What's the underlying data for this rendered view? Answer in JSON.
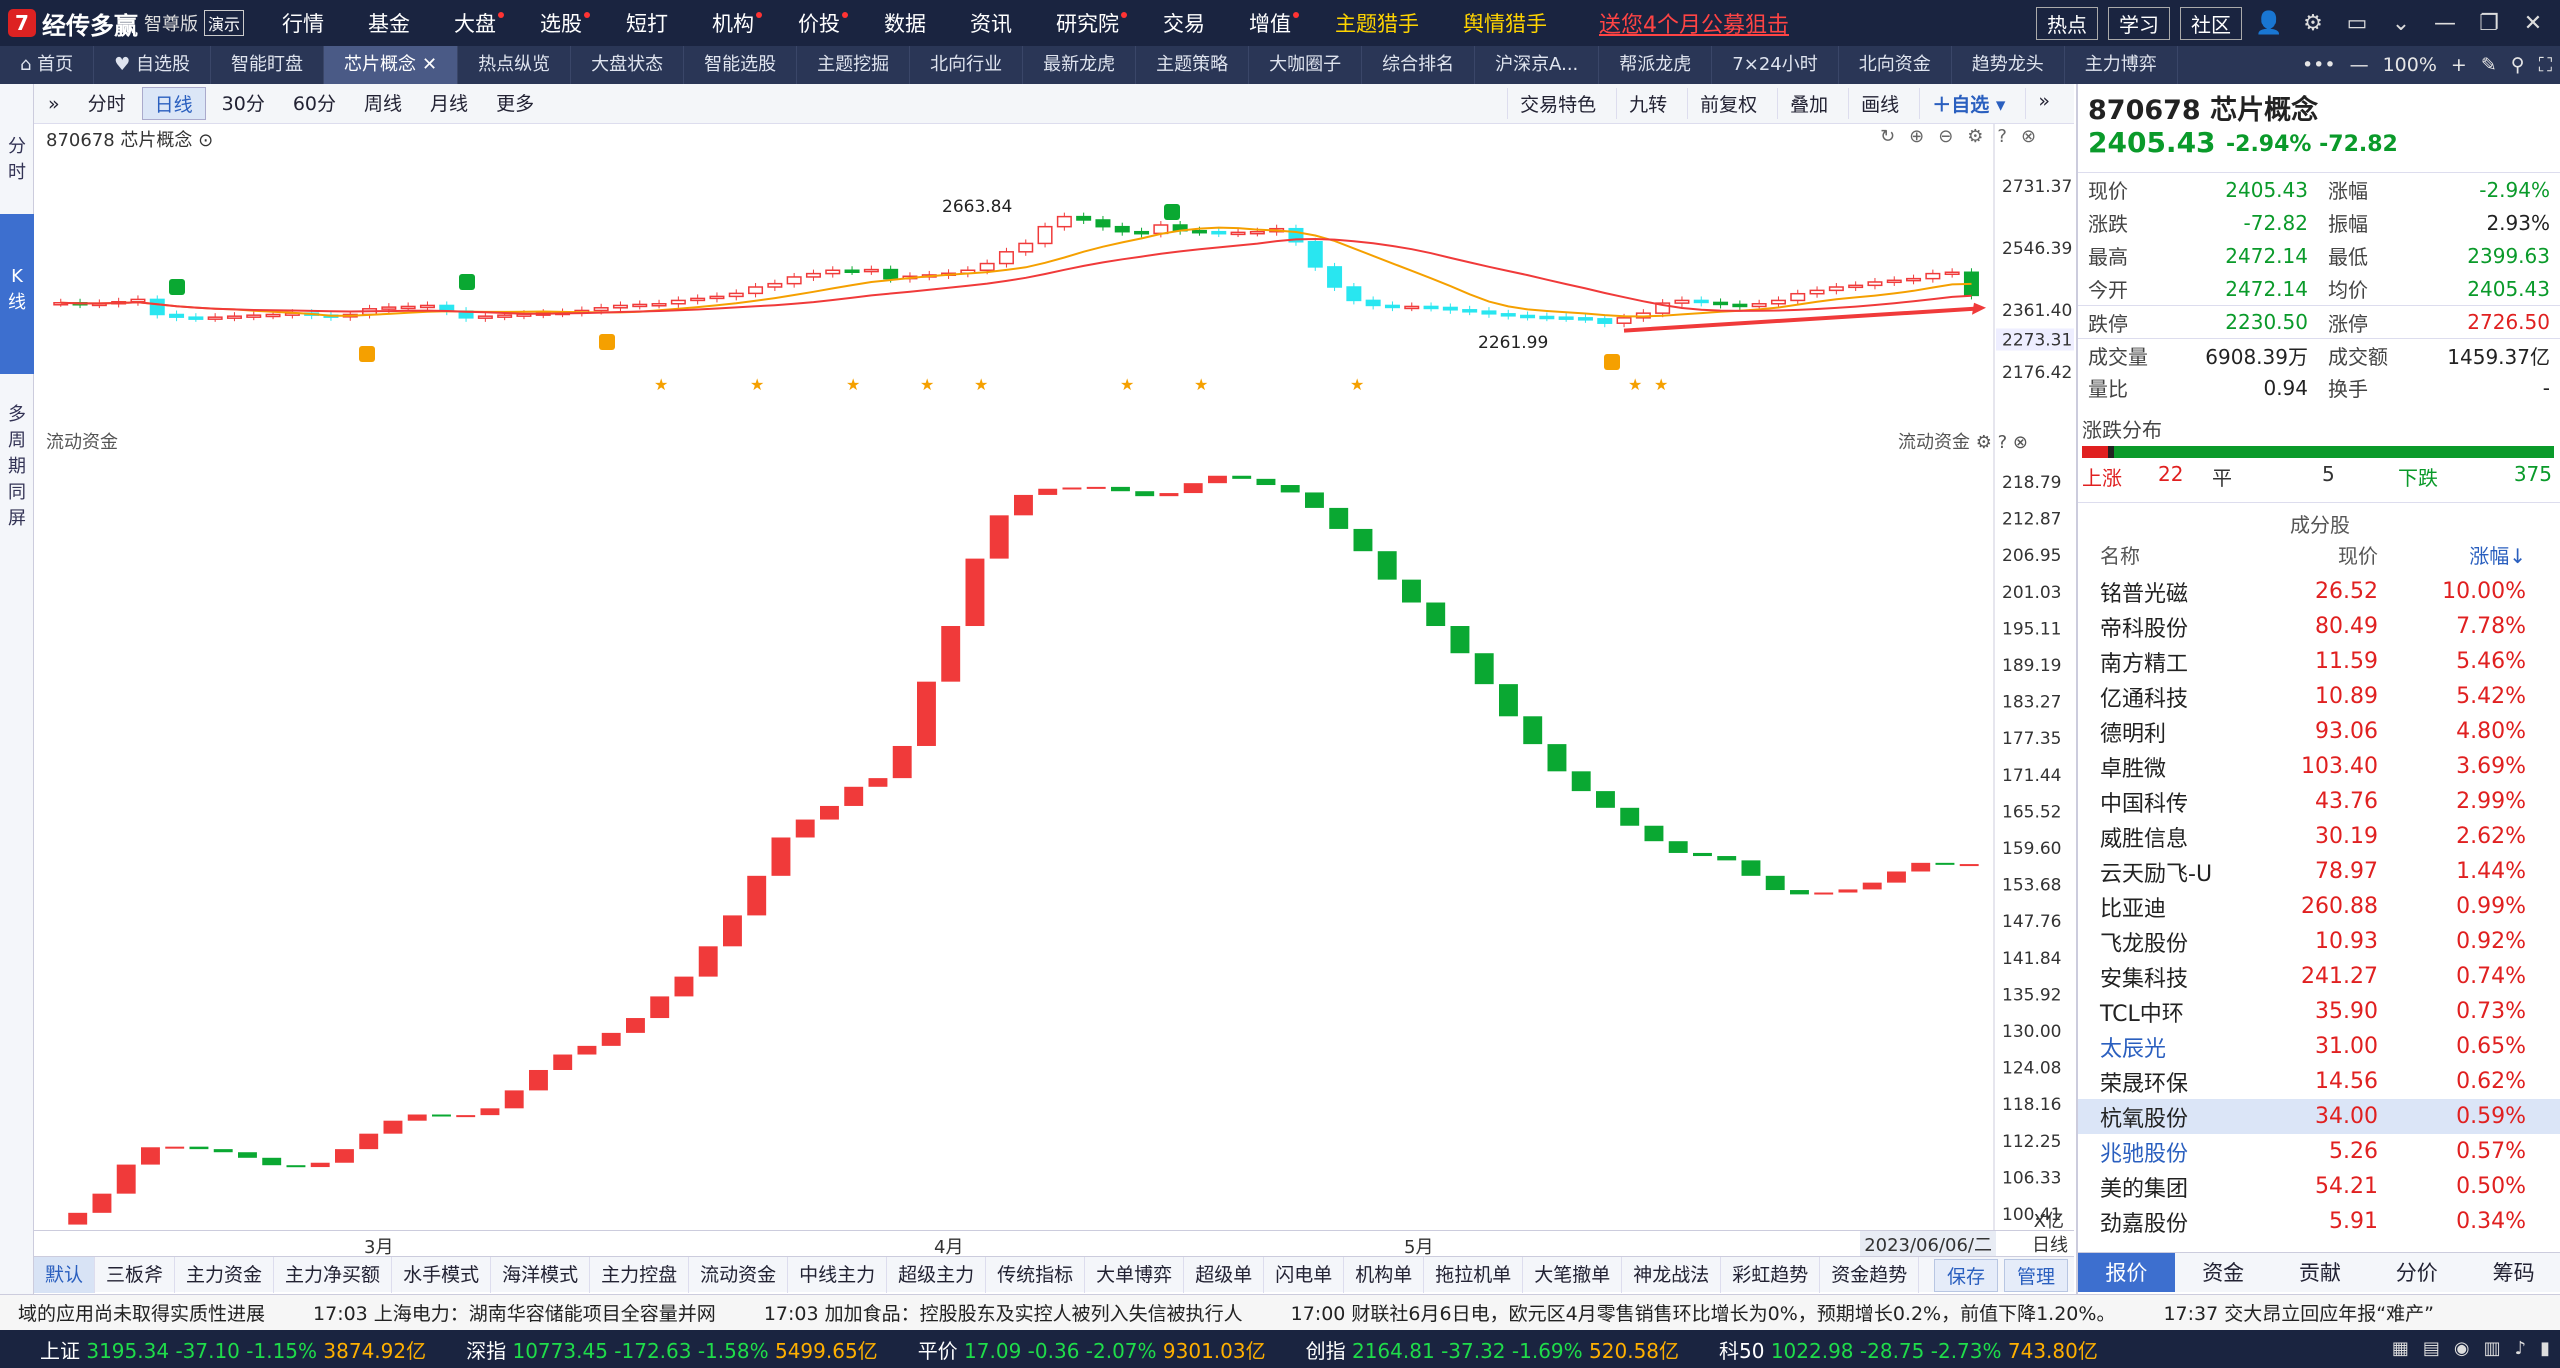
{
  "app": {
    "logo_mark": "7",
    "name": "经传多赢",
    "edition": "智尊版",
    "demo": "演示"
  },
  "main_menu": [
    "行情",
    "基金",
    "大盘",
    "选股",
    "短打",
    "机构",
    "价投",
    "数据",
    "资讯",
    "研究院",
    "交易",
    "增值",
    "主题猎手",
    "舆情猎手"
  ],
  "promo": "送您4个月公募狙击",
  "top_buttons": [
    "热点",
    "学习",
    "社区"
  ],
  "tabs": [
    {
      "label": "首页",
      "icon": "home-icon"
    },
    {
      "label": "自选股",
      "icon": "heart-icon"
    },
    {
      "label": "智能盯盘"
    },
    {
      "label": "芯片概念",
      "active": true,
      "close": "✕"
    },
    {
      "label": "热点纵览"
    },
    {
      "label": "大盘状态"
    },
    {
      "label": "智能选股"
    },
    {
      "label": "主题挖掘"
    },
    {
      "label": "北向行业"
    },
    {
      "label": "最新龙虎"
    },
    {
      "label": "主题策略"
    },
    {
      "label": "大咖圈子"
    },
    {
      "label": "综合排名"
    },
    {
      "label": "沪深京A..."
    },
    {
      "label": "帮派龙虎"
    },
    {
      "label": "7×24小时"
    },
    {
      "label": "北向资金"
    },
    {
      "label": "趋势龙头"
    },
    {
      "label": "主力博弈"
    }
  ],
  "zoom": "100%",
  "left_strip": [
    {
      "label": "分\n时"
    },
    {
      "label": "K\n线",
      "active": true
    },
    {
      "label": "多\n周\n期\n同\n屏"
    }
  ],
  "toolbar": {
    "items": [
      "分时",
      "日线",
      "30分",
      "60分",
      "周线",
      "月线",
      "更多"
    ],
    "active": "日线",
    "right": [
      "交易特色",
      "九转",
      "前复权",
      "叠加",
      "画线"
    ],
    "add": "自选"
  },
  "kchart_label": "870678 芯片概念",
  "kchart_prices": [
    "2731.37",
    "2546.39",
    "2361.40",
    "2273.31",
    "2176.42"
  ],
  "kchart_annot": {
    "high": "2663.84",
    "low": "2261.99"
  },
  "fund_title": "流动资金",
  "fund_axis": [
    "218.79",
    "212.87",
    "206.95",
    "201.03",
    "195.11",
    "189.19",
    "183.27",
    "177.35",
    "171.44",
    "165.52",
    "159.60",
    "153.68",
    "147.76",
    "141.84",
    "135.92",
    "130.00",
    "124.08",
    "118.16",
    "112.25",
    "106.33",
    "100.41"
  ],
  "fund_unit": "X亿",
  "x_months": [
    "3月",
    "4月",
    "5月"
  ],
  "x_date": "2023/06/06/二",
  "x_period": "日线",
  "indicators": [
    "默认",
    "三板斧",
    "主力资金",
    "主力净买额",
    "水手模式",
    "海洋模式",
    "主力控盘",
    "流动资金",
    "中线主力",
    "超级主力",
    "传统指标",
    "大单博弈",
    "超级单",
    "闪电单",
    "机构单",
    "拖拉机单",
    "大笔撤单",
    "神龙战法",
    "彩虹趋势",
    "资金趋势"
  ],
  "indicator_active": "默认",
  "ind_right": [
    "保存",
    "管理"
  ],
  "stock": {
    "title": "870678 芯片概念",
    "price": "2405.43",
    "pct": "-2.94%",
    "chg": "-72.82"
  },
  "quote": [
    {
      "l": "现价",
      "v": "2405.43",
      "c": "g",
      "l2": "涨幅",
      "v2": "-2.94%",
      "c2": "g"
    },
    {
      "l": "涨跌",
      "v": "-72.82",
      "c": "g",
      "l2": "振幅",
      "v2": "2.93%",
      "c2": "k"
    },
    {
      "l": "最高",
      "v": "2472.14",
      "c": "g",
      "l2": "最低",
      "v2": "2399.63",
      "c2": "g"
    },
    {
      "l": "今开",
      "v": "2472.14",
      "c": "g",
      "l2": "均价",
      "v2": "2405.43",
      "c2": "g"
    },
    {
      "l": "跌停",
      "v": "2230.50",
      "c": "g",
      "l2": "涨停",
      "v2": "2726.50",
      "c2": "r"
    },
    {
      "l": "成交量",
      "v": "6908.39万",
      "c": "k",
      "l2": "成交额",
      "v2": "1459.37亿",
      "c2": "k"
    },
    {
      "l": "量比",
      "v": "0.94",
      "c": "k",
      "l2": "换手",
      "v2": "-",
      "c2": "k"
    }
  ],
  "dist": {
    "title": "涨跌分布",
    "up_label": "上涨",
    "up": "22",
    "flat_label": "平",
    "flat": "5",
    "down_label": "下跌",
    "down": "375"
  },
  "components": {
    "title": "成分股",
    "head": [
      "名称",
      "现价",
      "涨幅↓"
    ],
    "rows": [
      {
        "n": "铭普光磁",
        "p": "26.52",
        "c": "10.00%"
      },
      {
        "n": "帝科股份",
        "p": "80.49",
        "c": "7.78%"
      },
      {
        "n": "南方精工",
        "p": "11.59",
        "c": "5.46%"
      },
      {
        "n": "亿通科技",
        "p": "10.89",
        "c": "5.42%"
      },
      {
        "n": "德明利",
        "p": "93.06",
        "c": "4.80%"
      },
      {
        "n": "卓胜微",
        "p": "103.40",
        "c": "3.69%"
      },
      {
        "n": "中国科传",
        "p": "43.76",
        "c": "2.99%"
      },
      {
        "n": "威胜信息",
        "p": "30.19",
        "c": "2.62%"
      },
      {
        "n": "云天励飞-U",
        "p": "78.97",
        "c": "1.44%"
      },
      {
        "n": "比亚迪",
        "p": "260.88",
        "c": "0.99%"
      },
      {
        "n": "飞龙股份",
        "p": "10.93",
        "c": "0.92%"
      },
      {
        "n": "安集科技",
        "p": "241.27",
        "c": "0.74%"
      },
      {
        "n": "TCL中环",
        "p": "35.90",
        "c": "0.73%"
      },
      {
        "n": "太辰光",
        "p": "31.00",
        "c": "0.65%",
        "blue": true
      },
      {
        "n": "荣晟环保",
        "p": "14.56",
        "c": "0.62%"
      },
      {
        "n": "杭氧股份",
        "p": "34.00",
        "c": "0.59%",
        "sel": true
      },
      {
        "n": "兆驰股份",
        "p": "5.26",
        "c": "0.57%",
        "blue": true
      },
      {
        "n": "美的集团",
        "p": "54.21",
        "c": "0.50%"
      },
      {
        "n": "劲嘉股份",
        "p": "5.91",
        "c": "0.34%"
      }
    ]
  },
  "right_tabs": [
    "报价",
    "资金",
    "贡献",
    "分价",
    "筹码"
  ],
  "news": [
    "域的应用尚未取得实质性进展",
    "17:03 上海电力：湖南华容储能项目全容量并网",
    "17:03 加加食品：控股股东及实控人被列入失信被执行人",
    "17:00 财联社6月6日电，欧元区4月零售销售环比增长为0%，预期增长0.2%，前值下降1.20%。",
    "17:37 交大昂立回应年报“难产”"
  ],
  "indices": [
    {
      "n": "上证",
      "v": "3195.34",
      "c": "-37.10",
      "p": "-1.15%",
      "a": "3874.92亿"
    },
    {
      "n": "深指",
      "v": "10773.45",
      "c": "-172.63",
      "p": "-1.58%",
      "a": "5499.65亿"
    },
    {
      "n": "平价",
      "v": "17.09",
      "c": "-0.36",
      "p": "-2.07%",
      "a": "9301.03亿"
    },
    {
      "n": "创指",
      "v": "2164.81",
      "c": "-37.32",
      "p": "-1.69%",
      "a": "520.58亿"
    },
    {
      "n": "科50",
      "v": "1022.98",
      "c": "-28.75",
      "p": "-2.73%",
      "a": "743.80亿"
    }
  ],
  "colors": {
    "up": "#f03a3a",
    "down": "#0aa832",
    "cyan": "#29e6f0",
    "accent": "#3d6fcf",
    "dark": "#1a2440"
  }
}
